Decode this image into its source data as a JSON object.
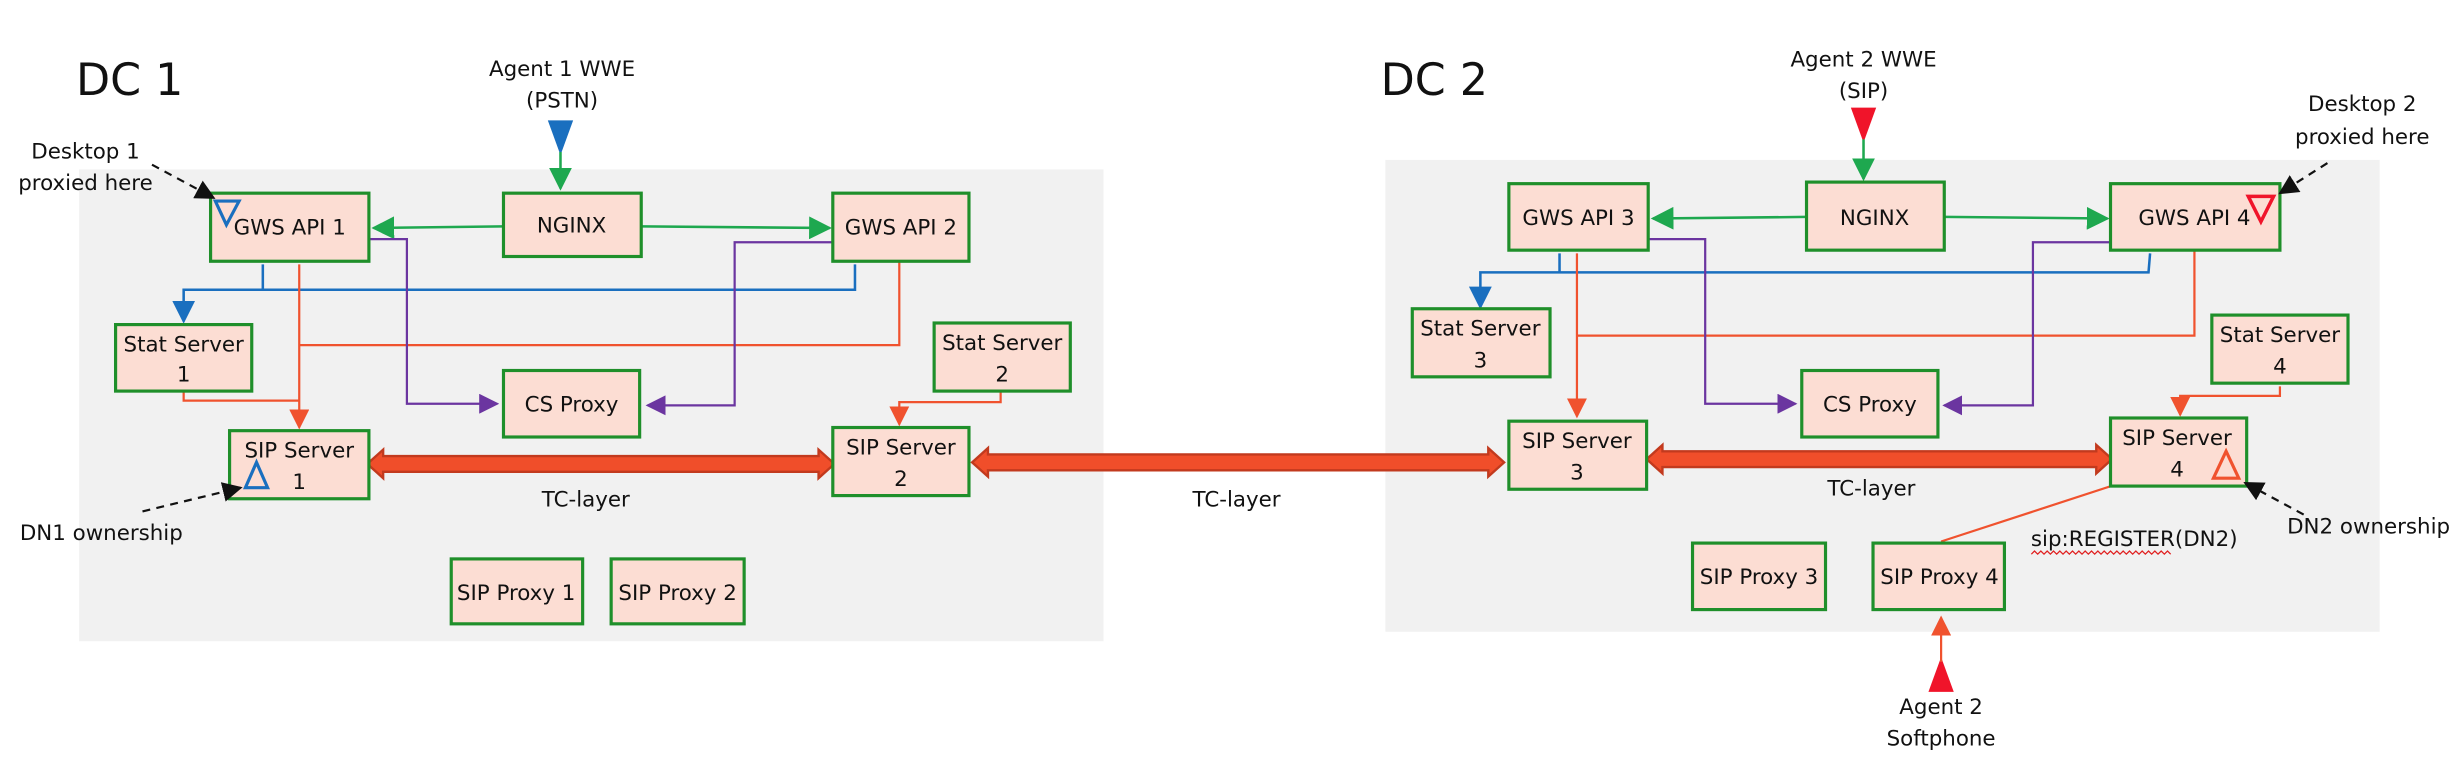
{
  "datacenters": [
    {
      "label": "DC 1"
    },
    {
      "label": "DC 2"
    }
  ],
  "nodes": {
    "gws_api_1": "GWS API 1",
    "gws_api_2": "GWS API 2",
    "nginx_1": "NGINX",
    "stat_server_1": [
      "Stat Server",
      "1"
    ],
    "stat_server_2": [
      "Stat Server",
      "2"
    ],
    "cs_proxy_1": "CS Proxy",
    "sip_server_1": [
      "SIP Server",
      "1"
    ],
    "sip_server_2": [
      "SIP Server",
      "2"
    ],
    "sip_proxy_1": "SIP Proxy 1",
    "sip_proxy_2": "SIP Proxy 2",
    "gws_api_3": "GWS API 3",
    "gws_api_4": "GWS API 4",
    "nginx_2": "NGINX",
    "stat_server_3": [
      "Stat Server",
      "3"
    ],
    "stat_server_4": [
      "Stat Server",
      "4"
    ],
    "cs_proxy_2": "CS Proxy",
    "sip_server_3": [
      "SIP Server",
      "3"
    ],
    "sip_server_4": [
      "SIP Server",
      "4"
    ],
    "sip_proxy_3": "SIP Proxy 3",
    "sip_proxy_4": "SIP Proxy 4"
  },
  "annotations": {
    "agent1": [
      "Agent 1 WWE",
      "(PSTN)"
    ],
    "agent2": [
      "Agent 2 WWE",
      "(SIP)"
    ],
    "desktop1": [
      "Desktop 1",
      "proxied  here"
    ],
    "desktop2": [
      "Desktop 2",
      "proxied  here"
    ],
    "dn1": "DN1 ownership",
    "dn2": "DN2 ownership",
    "tc_layer_dc1": "TC-layer",
    "tc_layer_between": "TC-layer",
    "tc_layer_dc2": "TC-layer",
    "sip_register": "sip:REGISTER(DN2)",
    "softphone": [
      "Agent 2",
      "Softphone"
    ]
  },
  "colors": {
    "box_fill": "#fcddd3",
    "box_border": "#1f8f2a",
    "region_fill": "#f1f1f1",
    "nginx_link": "#1ea84f",
    "stat_link": "#1a6fbf",
    "sip_link": "#f0522e",
    "csproxy_link": "#6b35a0",
    "tc_layer": "#f04e2a",
    "agent2_marker": "#f0142a"
  }
}
